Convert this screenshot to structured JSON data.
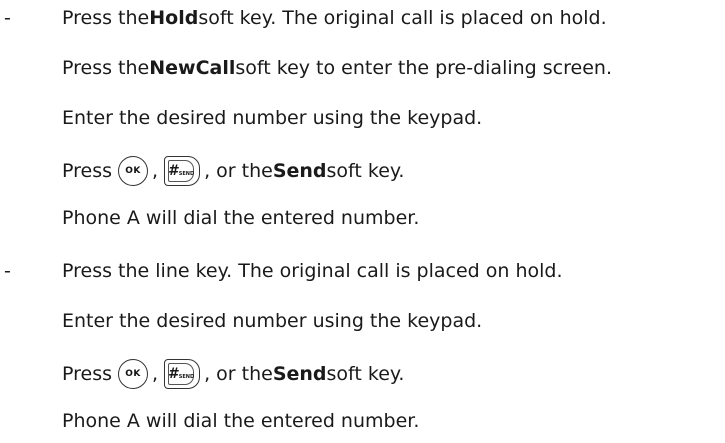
{
  "section1": {
    "dash": "-",
    "l1_pre": "Press the ",
    "l1_bold": "Hold",
    "l1_post": " soft key. The original call is placed on hold.",
    "l2_pre": "Press the ",
    "l2_bold": "NewCall",
    "l2_post": " soft key to enter the pre-dialing screen.",
    "l3": "Enter the desired number using the keypad.",
    "l4_pre": "Press",
    "l4_comma": ",",
    "l4_mid": ", or the ",
    "l4_bold": "Send",
    "l4_post": " soft key.",
    "l5": "Phone A will dial the entered number."
  },
  "section2": {
    "dash": "-",
    "l1": "Press the line key. The original call is placed on hold.",
    "l2": "Enter the desired number using the keypad.",
    "l3_pre": "Press",
    "l3_comma": ",",
    "l3_mid": ", or the ",
    "l3_bold": "Send",
    "l3_post": " soft key.",
    "l4": "Phone A will dial the entered number."
  },
  "keys": {
    "ok_label": "OK",
    "hash_glyph": "#",
    "hash_sub": "SEND",
    "ok_icon": "ok-key-icon",
    "hash_icon": "hash-send-key-icon"
  }
}
